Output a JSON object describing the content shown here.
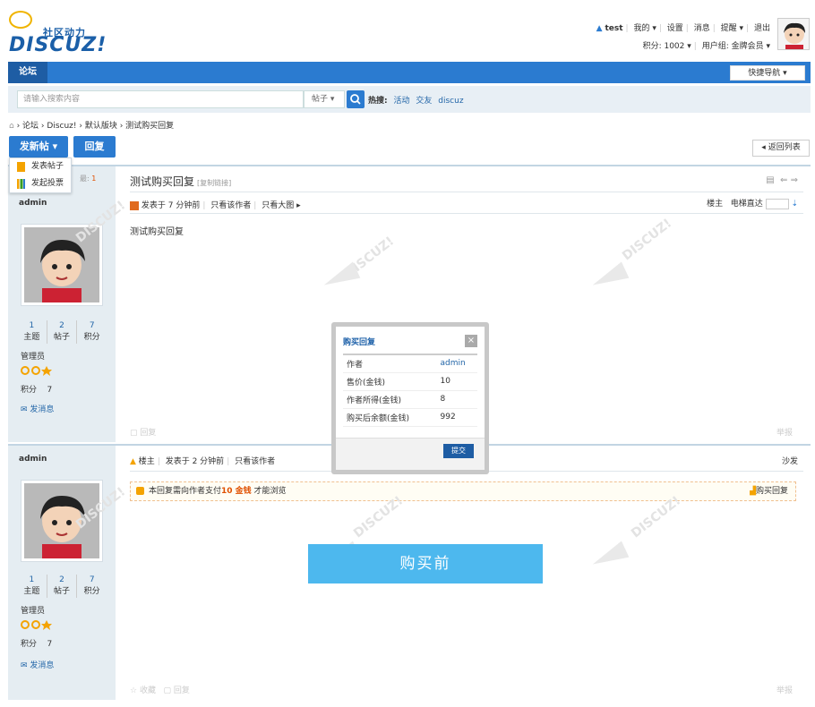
{
  "site": {
    "tagline": "社区动力",
    "logo_word": "DISCUZ!"
  },
  "userbar": {
    "username": "test",
    "my": "我的",
    "settings": "设置",
    "messages": "消息",
    "reminders": "提醒",
    "logout": "退出",
    "points": "积分: 1002",
    "usergroup": "用户组: 金牌会员"
  },
  "nav": {
    "current": "论坛",
    "quick_nav": "快捷导航"
  },
  "search": {
    "placeholder": "请输入搜索内容",
    "type": "帖子",
    "hot_label": "热搜:",
    "hot_terms": [
      "活动",
      "交友",
      "discuz"
    ]
  },
  "breadcrumb": [
    "论坛",
    "Discuz!",
    "默认版块",
    "测试购买回复"
  ],
  "actions": {
    "new_post": "发新帖",
    "reply": "回复",
    "back_list": "返回列表"
  },
  "dropdown": {
    "post_thread": "发表帖子",
    "post_poll": "发起投票",
    "behind_label": "最:",
    "behind_count": "1"
  },
  "post1": {
    "title": "测试购买回复",
    "copy_link": "[复制链接]",
    "meta": "发表于 7 分钟前",
    "only_author": "只看该作者",
    "big_image": "只看大图",
    "floor_owner": "楼主",
    "elevator": "电梯直达",
    "content": "测试购买回复",
    "reply_faint": "回复",
    "report_faint": "举报"
  },
  "post2": {
    "role": "楼主",
    "meta": "发表于 2 分钟前",
    "only_author": "只看该作者",
    "floor": "沙发",
    "locked_prefix": "本回复需向作者支付",
    "locked_cost": "10 金钱",
    "locked_suffix": " 才能浏览",
    "buy_reply": "购买回复",
    "favorite_faint": "收藏",
    "reply_faint": "回复",
    "report_faint": "举报"
  },
  "author": {
    "name": "admin",
    "stats": [
      {
        "value": "1",
        "label": "主题"
      },
      {
        "value": "2",
        "label": "帖子"
      },
      {
        "value": "7",
        "label": "积分"
      }
    ],
    "role": "管理员",
    "points_label": "积分",
    "points_value": "7",
    "send_msg": "发消息"
  },
  "modal": {
    "title": "购买回复",
    "close": "×",
    "rows": [
      {
        "label": "作者",
        "value": "admin"
      },
      {
        "label": "售价(金钱)",
        "value": "10"
      },
      {
        "label": "作者所得(金钱)",
        "value": "8"
      },
      {
        "label": "购买后余额(金钱)",
        "value": "992"
      }
    ],
    "submit": "提交"
  },
  "banner": {
    "text": "购买前"
  },
  "colors": {
    "brand_blue": "#2b7bd0",
    "dark_blue": "#1e5da4",
    "banner": "#4db8ee",
    "cost": "#e05000"
  }
}
